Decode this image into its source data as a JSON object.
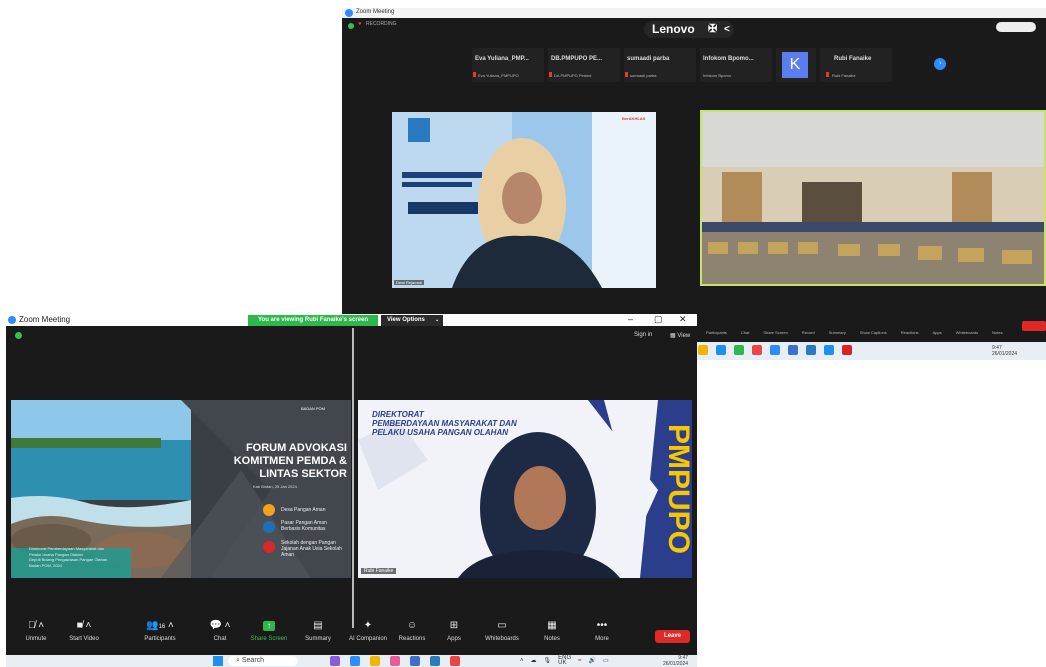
{
  "back_window": {
    "title": "Zoom Meeting",
    "recording": "RECORDING",
    "brand": "Lenovo",
    "participants": [
      {
        "name": "Eva Yuliana_PMP...",
        "sub": "Eva Yuliana_PMPUPO"
      },
      {
        "name": "DB.PMPUPO PE...",
        "sub": "DA PMPUPO Pinbed"
      },
      {
        "name": "sumaadi parba",
        "sub": "sumaadi parba"
      },
      {
        "name": "Infokom Bpomo...",
        "sub": "Infokom Bpomo"
      }
    ],
    "k_avatar": "K",
    "k_sub": "Rubi",
    "rubi_name": "Rubi Fanaike",
    "rubi_sub": "Rubi Fanaike",
    "video1_label": "Dewi Rejamati",
    "video1_badge": "BerAKHLAK",
    "controls": [
      "Participants",
      "Chat",
      "Share Screen",
      "Record",
      "Summary",
      "Show Captions",
      "Reactions",
      "Apps",
      "Whiteboards",
      "Notes"
    ],
    "tray_time": "9:47",
    "tray_date": "26/01/2024"
  },
  "front_window": {
    "title": "Zoom Meeting",
    "viewing_banner": "You are viewing Rubi Fanaike's screen",
    "view_options": "View Options",
    "sign_in": "Sign in",
    "view": "View",
    "window_controls": [
      "–",
      "▢",
      "✕"
    ],
    "slide": {
      "logo_text": "BADAN POM",
      "title": "FORUM ADVOKASI KOMITMEN PEMDA & LINTAS SEKTOR",
      "date": "Kab Bintan, 25 Jan 2024",
      "bullets": [
        "Desa Pangan Aman",
        "Pasar Pangan Aman Berbasis Komunitas",
        "Sekolah dengan Pangan Jajanan Anak Usia Sekolah Aman"
      ],
      "footer": [
        "Direktorat Pemberdayaan Masyarakat dan",
        "Pelaku Usaha Pangan Olahan",
        "Deputi Bidang Pengawasan Pangan Olahan",
        "Badan POM, 2024"
      ]
    },
    "video": {
      "heading_line1": "DIREKTORAT",
      "heading_line2": "PEMBERDAYAAN MASYARAKAT DAN",
      "heading_line3": "PELAKU USAHA PANGAN OLAHAN",
      "vertical_text": "PMPUPO",
      "speaker_name": "Rubi Fanaike"
    },
    "controls": [
      {
        "label": "Unmute",
        "icon": "mic-off-icon"
      },
      {
        "label": "Start Video",
        "icon": "video-off-icon"
      },
      {
        "label": "Participants",
        "icon": "participants-icon",
        "count": "16"
      },
      {
        "label": "Chat",
        "icon": "chat-icon"
      },
      {
        "label": "Share Screen",
        "icon": "share-screen-icon"
      },
      {
        "label": "Summary",
        "icon": "summary-icon"
      },
      {
        "label": "AI Companion",
        "icon": "ai-companion-icon"
      },
      {
        "label": "Reactions",
        "icon": "reactions-icon"
      },
      {
        "label": "Apps",
        "icon": "apps-icon"
      },
      {
        "label": "Whiteboards",
        "icon": "whiteboards-icon"
      },
      {
        "label": "Notes",
        "icon": "notes-icon"
      },
      {
        "label": "More",
        "icon": "more-icon"
      }
    ],
    "leave": "Leave"
  },
  "taskbar": {
    "search": "Search",
    "lang": "ENG",
    "lang_sub": "UK",
    "time": "9:47",
    "date": "26/01/2024"
  },
  "colors": {
    "accent_green": "#2db84b",
    "leave_red": "#e02828",
    "zoom_blue": "#2d8cff",
    "pmpupo_yellow": "#f7c800"
  }
}
